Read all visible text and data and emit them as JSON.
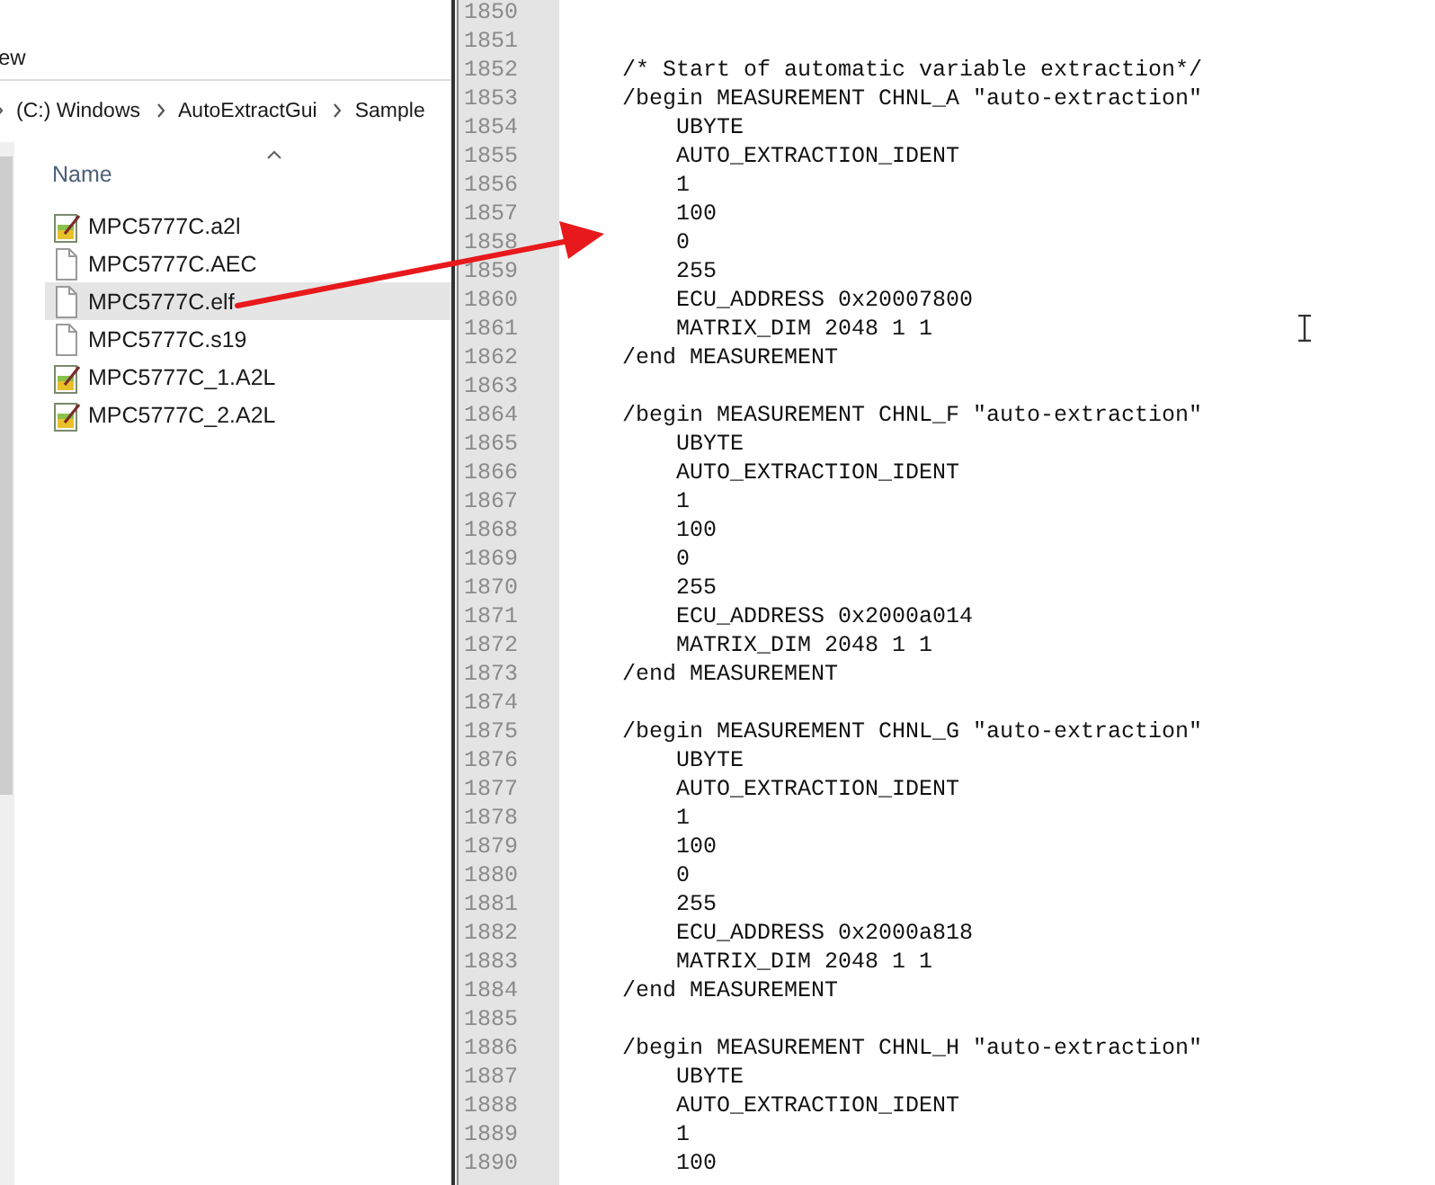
{
  "explorer": {
    "menu_fragment": "ew",
    "breadcrumb": [
      "(C:) Windows",
      "AutoExtractGui",
      "Sample"
    ],
    "column_header": "Name",
    "files": [
      {
        "name": "MPC5777C.a2l",
        "kind": "a2l",
        "selected": false
      },
      {
        "name": "MPC5777C.AEC",
        "kind": "file",
        "selected": false
      },
      {
        "name": "MPC5777C.elf",
        "kind": "file",
        "selected": true
      },
      {
        "name": "MPC5777C.s19",
        "kind": "file",
        "selected": false
      },
      {
        "name": "MPC5777C_1.A2L",
        "kind": "a2l",
        "selected": false
      },
      {
        "name": "MPC5777C_2.A2L",
        "kind": "a2l",
        "selected": false
      }
    ]
  },
  "editor": {
    "lines": [
      {
        "number": "1850"
      },
      {
        "number": "1851"
      },
      {
        "number": "1852",
        "text": "/* Start of automatic variable extraction*/"
      },
      {
        "number": "1853",
        "text": "/begin MEASUREMENT CHNL_A \"auto-extraction\""
      },
      {
        "number": "1854",
        "text": "    UBYTE"
      },
      {
        "number": "1855",
        "text": "    AUTO_EXTRACTION_IDENT"
      },
      {
        "number": "1856",
        "text": "    1"
      },
      {
        "number": "1857",
        "text": "    100"
      },
      {
        "number": "1858",
        "text": "    0"
      },
      {
        "number": "1859",
        "text": "    255"
      },
      {
        "number": "1860",
        "text": "    ECU_ADDRESS 0x20007800"
      },
      {
        "number": "1861",
        "text": "    MATRIX_DIM 2048 1 1"
      },
      {
        "number": "1862",
        "text": "/end MEASUREMENT"
      },
      {
        "number": "1863"
      },
      {
        "number": "1864",
        "text": "/begin MEASUREMENT CHNL_F \"auto-extraction\""
      },
      {
        "number": "1865",
        "text": "    UBYTE"
      },
      {
        "number": "1866",
        "text": "    AUTO_EXTRACTION_IDENT"
      },
      {
        "number": "1867",
        "text": "    1"
      },
      {
        "number": "1868",
        "text": "    100"
      },
      {
        "number": "1869",
        "text": "    0"
      },
      {
        "number": "1870",
        "text": "    255"
      },
      {
        "number": "1871",
        "text": "    ECU_ADDRESS 0x2000a014"
      },
      {
        "number": "1872",
        "text": "    MATRIX_DIM 2048 1 1"
      },
      {
        "number": "1873",
        "text": "/end MEASUREMENT"
      },
      {
        "number": "1874"
      },
      {
        "number": "1875",
        "text": "/begin MEASUREMENT CHNL_G \"auto-extraction\""
      },
      {
        "number": "1876",
        "text": "    UBYTE"
      },
      {
        "number": "1877",
        "text": "    AUTO_EXTRACTION_IDENT"
      },
      {
        "number": "1878",
        "text": "    1"
      },
      {
        "number": "1879",
        "text": "    100"
      },
      {
        "number": "1880",
        "text": "    0"
      },
      {
        "number": "1881",
        "text": "    255"
      },
      {
        "number": "1882",
        "text": "    ECU_ADDRESS 0x2000a818"
      },
      {
        "number": "1883",
        "text": "    MATRIX_DIM 2048 1 1"
      },
      {
        "number": "1884",
        "text": "/end MEASUREMENT"
      },
      {
        "number": "1885"
      },
      {
        "number": "1886",
        "text": "/begin MEASUREMENT CHNL_H \"auto-extraction\""
      },
      {
        "number": "1887",
        "text": "    UBYTE"
      },
      {
        "number": "1888",
        "text": "    AUTO_EXTRACTION_IDENT"
      },
      {
        "number": "1889",
        "text": "    1"
      },
      {
        "number": "1890",
        "text": "    100"
      }
    ]
  }
}
